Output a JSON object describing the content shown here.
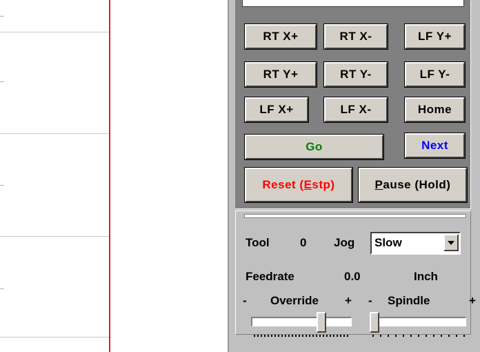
{
  "buttons": {
    "rt_x_plus": "RT X+",
    "rt_x_minus": "RT X-",
    "lf_y_plus": "LF Y+",
    "rt_y_plus": "RT Y+",
    "rt_y_minus": "RT Y-",
    "lf_y_minus": "LF Y-",
    "lf_x_plus": "LF X+",
    "lf_x_minus": "LF X-",
    "home": "Home",
    "go": "Go",
    "next": "Next",
    "reset_prefix": "Reset (",
    "reset_accel": "E",
    "reset_suffix": "stp)",
    "pause_accel": "P",
    "pause_suffix": "ause (Hold)"
  },
  "status": {
    "tool_label": "Tool",
    "tool_value": "0",
    "jog_label": "Jog",
    "jog_selected": "Slow",
    "feedrate_label": "Feedrate",
    "feedrate_value": "0.0",
    "units": "Inch"
  },
  "sliders": {
    "override_minus": "-",
    "override_label": "Override",
    "override_plus": "+",
    "spindle_minus": "-",
    "spindle_label": "Spindle",
    "spindle_plus": "+",
    "override_level": 0.72,
    "spindle_level": 0.0
  },
  "colors": {
    "go_text": "#008000",
    "next_text": "#0000ff",
    "reset_text": "#ff0000",
    "canvas_line": "#e31d1d",
    "panel_dark": "#808080",
    "panel_light": "#c0c0c0"
  },
  "icons": {
    "dropdown": "chevron-down-icon"
  }
}
